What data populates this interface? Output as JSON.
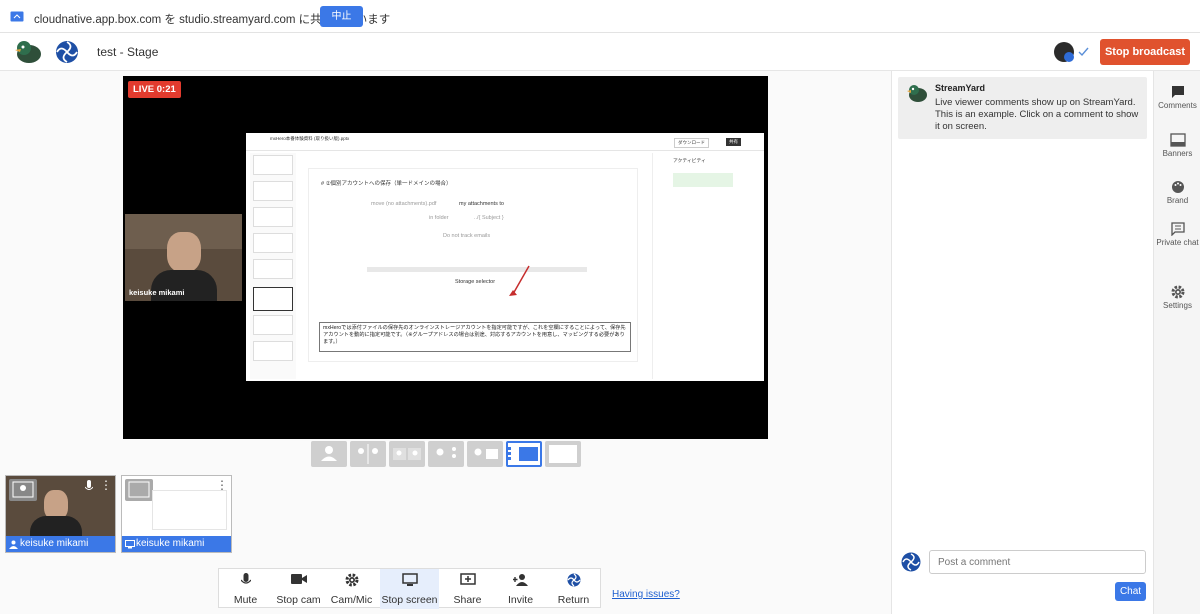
{
  "share_bar": {
    "text": "cloudnative.app.box.com を studio.streamyard.com に共有しています",
    "stop_label": "中止"
  },
  "header": {
    "title": "test - Stage",
    "stop_broadcast": "Stop broadcast"
  },
  "stage": {
    "live_label": "LIVE 0:21",
    "camera_name": "keisuke mikami",
    "slide": {
      "title": "mxHero本番体験資料 (取り扱い版).pptx",
      "heading": "# ②個別アカウントへの保存（単一ドメインの場合）",
      "rule_move": "move (no attachments).pdf",
      "rule_to": "my attachments to",
      "folder": "in folder",
      "subject": "../{ Subject }",
      "track": "Do not track emails",
      "storage_selector": "Storage selector",
      "note": "mxHeroでは添付ファイルの保存先のオンラインストレージアカウントを指定可能ですが、これを空欄にすることによって、保存先アカウントを動的に指定可能です。（※グループアドレスの場合は別途、対応するアカウントを用意し、マッピングする必要があります。）",
      "activity": "アクティビティ",
      "download": "ダウンロード",
      "share": "共有"
    }
  },
  "thumbs": [
    {
      "label": "keisuke mikami"
    },
    {
      "label": "keisuke mikami"
    }
  ],
  "controls": {
    "mute": "Mute",
    "stop_cam": "Stop cam",
    "cam_mic": "Cam/Mic",
    "stop_screen": "Stop screen",
    "share": "Share",
    "invite": "Invite",
    "return": "Return"
  },
  "having_issues": "Having issues?",
  "chat": {
    "sender": "StreamYard",
    "message": "Live viewer comments show up on StreamYard. This is an example. Click on a comment to show it on screen.",
    "placeholder": "Post a comment",
    "send": "Chat"
  },
  "side": {
    "comments": "Comments",
    "banners": "Banners",
    "brand": "Brand",
    "private_chat": "Private chat",
    "settings": "Settings"
  },
  "colors": {
    "accent": "#3b78e7",
    "stop": "#e0522e",
    "live": "#e23b2e"
  }
}
